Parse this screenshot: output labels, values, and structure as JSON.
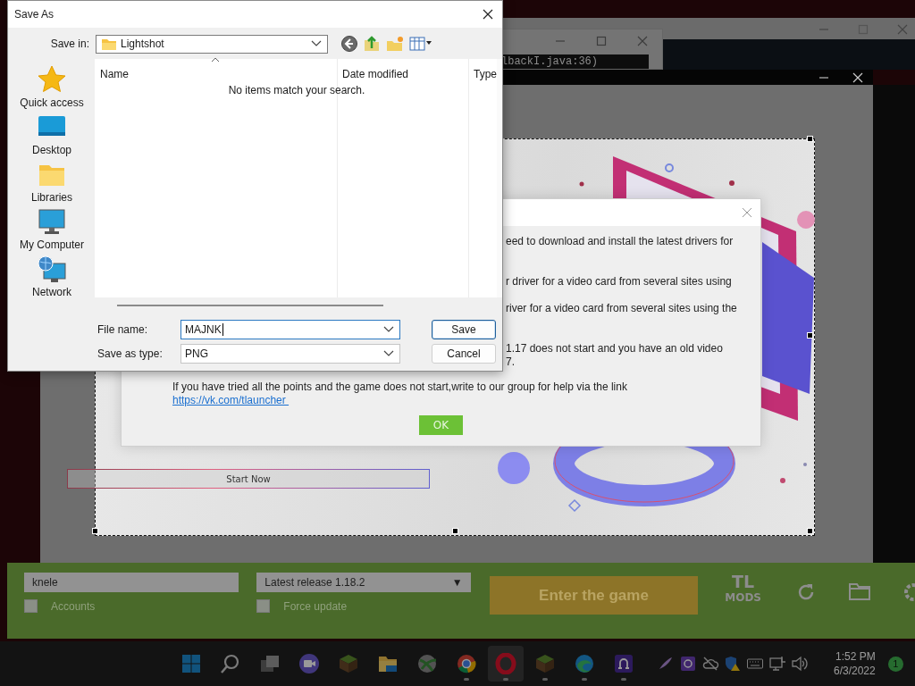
{
  "background_windows": {
    "console_line": "lbackI.java:36)"
  },
  "launcher": {
    "start_button": "Start Now",
    "username": "knele",
    "version": "Latest release 1.18.2",
    "version_arrow": "▼",
    "options": [
      {
        "label": "Accounts",
        "checked": false
      },
      {
        "label": "Force update",
        "checked": false
      }
    ],
    "play_button": "Enter the game",
    "logo": {
      "top": "TL",
      "bottom": "MODS"
    }
  },
  "info_dialog": {
    "lines": [
      "eed to download and install the latest drivers for",
      "r driver for a video card from several sites using",
      "river for a video card from several sites using the",
      "1.17 does not start and you have an old video",
      "7."
    ],
    "message": "If you have tried all the points and the game does not start,write to our group for help via the link",
    "link": "https://vk.com/tlauncher ",
    "ok_button": "OK"
  },
  "save_dialog": {
    "title": "Save As",
    "save_in_label": "Save in:",
    "location": "Lightshot",
    "places": [
      {
        "label": "Quick access",
        "kind": "star"
      },
      {
        "label": "Desktop",
        "kind": "desktop"
      },
      {
        "label": "Libraries",
        "kind": "folder"
      },
      {
        "label": "My Computer",
        "kind": "computer"
      },
      {
        "label": "Network",
        "kind": "network"
      }
    ],
    "columns": [
      "Name",
      "Date modified",
      "Type"
    ],
    "empty_message": "No items match your search.",
    "file_name_label": "File name:",
    "file_name": {
      "value": "MAJNK",
      "focused": true
    },
    "type_label": "Save as type:",
    "file_type": {
      "value": "PNG",
      "focused": false
    },
    "buttons": [
      {
        "label": "Save",
        "default": true
      },
      {
        "label": "Cancel",
        "default": false
      }
    ]
  },
  "taskbar": {
    "apps": [
      {
        "kind": "start",
        "running": false,
        "selected": false
      },
      {
        "kind": "search",
        "running": false,
        "selected": false
      },
      {
        "kind": "task-view",
        "running": false,
        "selected": false
      },
      {
        "kind": "video-call",
        "running": false,
        "selected": false
      },
      {
        "kind": "grass-block",
        "running": false,
        "selected": false
      },
      {
        "kind": "folder",
        "running": false,
        "selected": false
      },
      {
        "kind": "sphere",
        "running": false,
        "selected": false
      },
      {
        "kind": "chrome",
        "running": true,
        "selected": false
      },
      {
        "kind": "opera",
        "running": true,
        "selected": true
      },
      {
        "kind": "grass-block",
        "running": true,
        "selected": false
      },
      {
        "kind": "edge",
        "running": true,
        "selected": false
      },
      {
        "kind": "ring-app",
        "running": true,
        "selected": false
      }
    ],
    "tray": [
      {
        "kind": "feather"
      },
      {
        "kind": "tile"
      },
      {
        "kind": "cloud"
      },
      {
        "kind": "shield"
      },
      {
        "kind": "keyboard"
      },
      {
        "kind": "network"
      },
      {
        "kind": "volume"
      }
    ],
    "time": "1:52 PM",
    "date": "6/3/2022",
    "notification_count": "1"
  }
}
